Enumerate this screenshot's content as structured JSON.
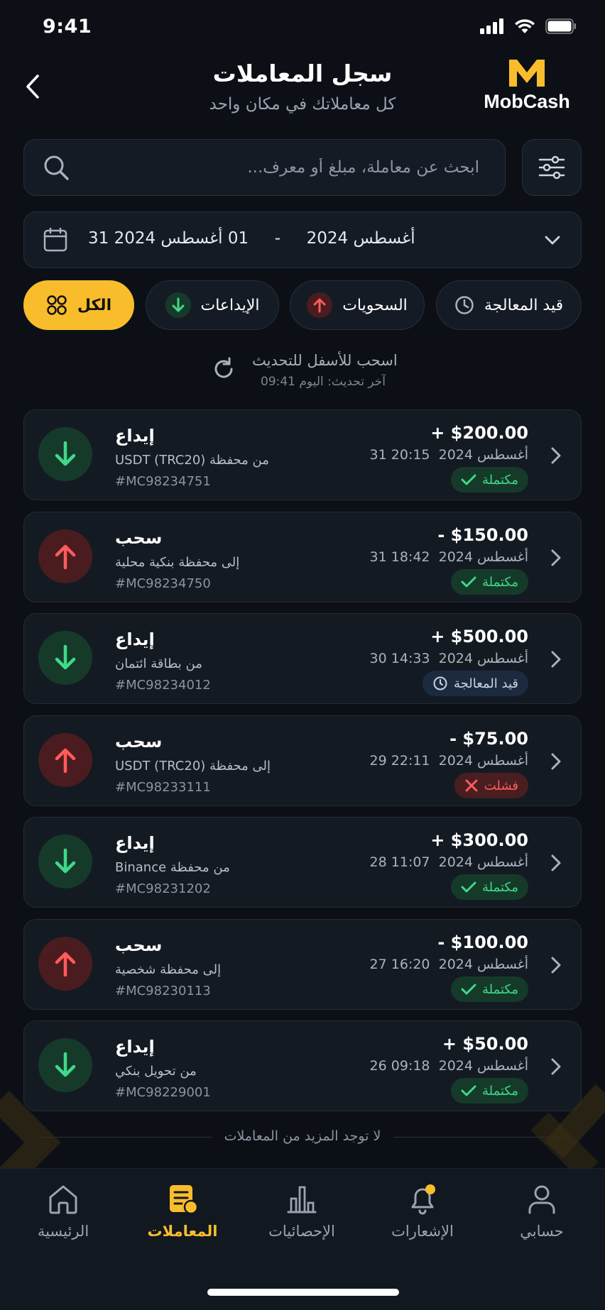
{
  "status": {
    "time": "9:41"
  },
  "header": {
    "title": "سجل المعاملات",
    "subtitle": "كل معاملاتك في مكان واحد",
    "logo_text": "MobCash"
  },
  "search": {
    "placeholder": "ابحث عن معاملة، مبلغ أو معرف..."
  },
  "date_range": {
    "from": "01 أغسطس 2024",
    "separator": "-",
    "to": "31 أغسطس 2024"
  },
  "filters": {
    "all": "الكل",
    "deposits": "الإيداعات",
    "withdrawals": "السحويات",
    "pending": "قيد المعالجة"
  },
  "refresh": {
    "title": "اسحب للأسفل للتحديث",
    "last_update": "آخر تحديث: اليوم 09:41"
  },
  "transactions": [
    {
      "type": "إيداع",
      "source": "من محفظة USDT (TRC20)",
      "id": "#MC98234751",
      "amount": "+ $200.00",
      "date": "31 أغسطس 2024  20:15",
      "status": "مكتملة",
      "status_kind": "ok",
      "direction": "dep"
    },
    {
      "type": "سحب",
      "source": "إلى محفظة بنكية محلية",
      "id": "#MC98234750",
      "amount": "- $150.00",
      "date": "31 أغسطس 2024  18:42",
      "status": "مكتملة",
      "status_kind": "ok",
      "direction": "wd"
    },
    {
      "type": "إيداع",
      "source": "من بطاقة ائتمان",
      "id": "#MC98234012",
      "amount": "+ $500.00",
      "date": "30 أغسطس 2024  14:33",
      "status": "قيد المعالجة",
      "status_kind": "pending",
      "direction": "dep"
    },
    {
      "type": "سحب",
      "source": "إلى محفظة USDT (TRC20)",
      "id": "#MC98233111",
      "amount": "- $75.00",
      "date": "29 أغسطس 2024  22:11",
      "status": "فشلت",
      "status_kind": "fail",
      "direction": "wd"
    },
    {
      "type": "إيداع",
      "source": "من محفظة Binance",
      "id": "#MC98231202",
      "amount": "+ $300.00",
      "date": "28 أغسطس 2024  11:07",
      "status": "مكتملة",
      "status_kind": "ok",
      "direction": "dep"
    },
    {
      "type": "سحب",
      "source": "إلى محفظة شخصية",
      "id": "#MC98230113",
      "amount": "- $100.00",
      "date": "27 أغسطس 2024  16:20",
      "status": "مكتملة",
      "status_kind": "ok",
      "direction": "wd"
    },
    {
      "type": "إيداع",
      "source": "من تحويل بنكي",
      "id": "#MC98229001",
      "amount": "+ $50.00",
      "date": "26 أغسطس 2024  09:18",
      "status": "مكتملة",
      "status_kind": "ok",
      "direction": "dep"
    }
  ],
  "end_text": "لا توجد المزيد من المعاملات",
  "tabs": {
    "home": "الرئيسية",
    "transactions": "المعاملات",
    "stats": "الإحصائيات",
    "notifications": "الإشعارات",
    "account": "حسابي"
  },
  "colors": {
    "accent": "#f9bd2c",
    "success": "#3fd98a",
    "danger": "#ff5b5b",
    "background": "#0c1016"
  }
}
